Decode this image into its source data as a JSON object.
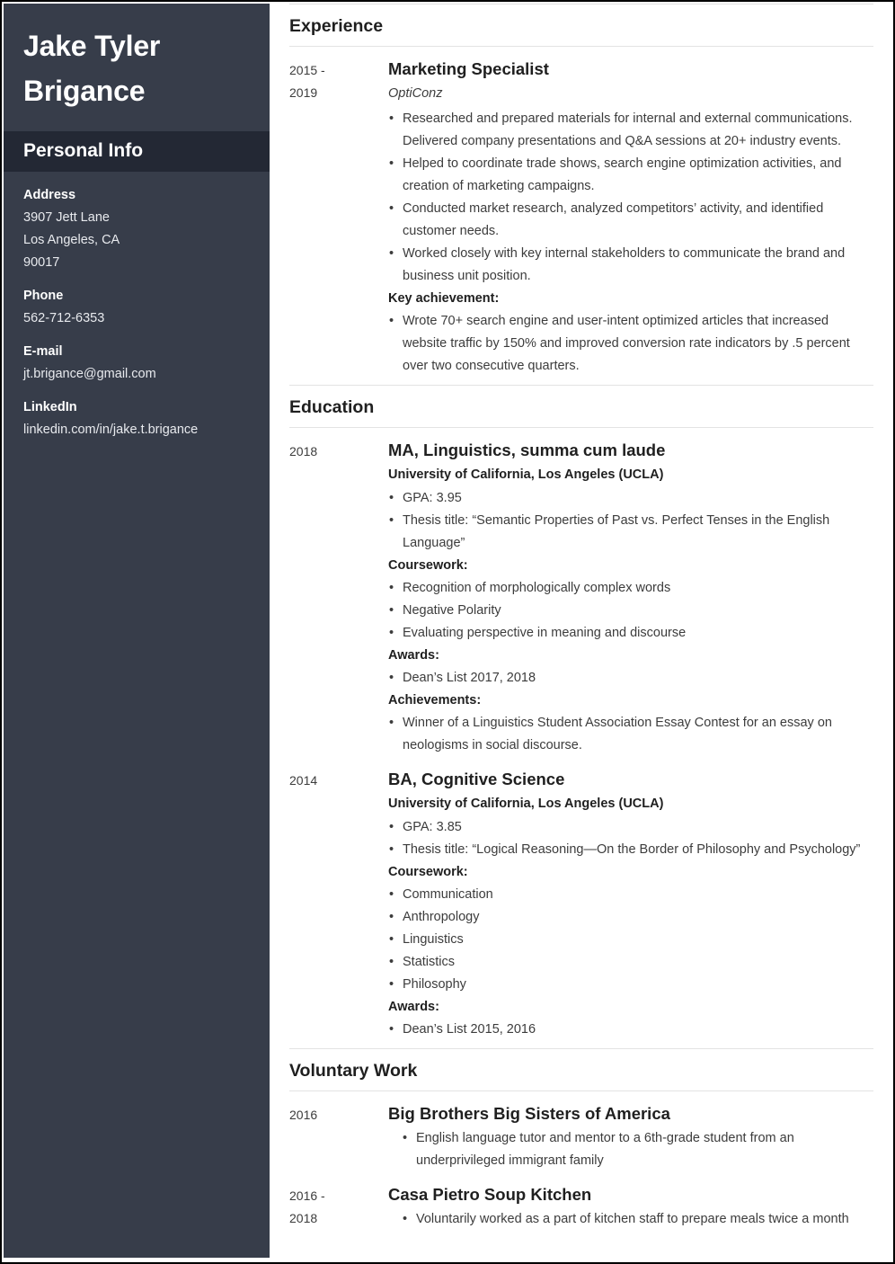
{
  "theme": {
    "sidebar_bg": "#373d4a",
    "sidebar_band_bg": "#232834",
    "sidebar_text": "#ffffff",
    "main_bg": "#ffffff",
    "heading_color": "#1f1f1f",
    "body_color": "#3c3c3c",
    "rule_color": "#e3e3e3",
    "page_border": "#000000"
  },
  "sidebar": {
    "name_line1": "Jake Tyler",
    "name_line2": "Brigance",
    "personal_info_title": "Personal Info",
    "info": [
      {
        "label": "Address",
        "values": [
          "3907 Jett Lane",
          "Los Angeles, CA",
          "90017"
        ]
      },
      {
        "label": "Phone",
        "values": [
          "562-712-6353"
        ]
      },
      {
        "label": "E-mail",
        "values": [
          "jt.brigance@gmail.com"
        ]
      },
      {
        "label": "LinkedIn",
        "values": [
          "linkedin.com/in/jake.t.brigance"
        ]
      }
    ]
  },
  "main": {
    "sections": [
      {
        "heading": "Experience",
        "entries": [
          {
            "dates_line1": "2015 -",
            "dates_line2": "2019",
            "title": "Marketing Specialist",
            "org_italic": "OptiConz",
            "bullets": [
              "Researched and prepared materials for internal and external communications. Delivered company presentations and Q&A sessions at 20+ industry events.",
              "Helped to coordinate trade shows, search engine optimization activities, and creation of marketing campaigns.",
              "Conducted market research, analyzed competitors’ activity, and identified customer needs.",
              "Worked closely with key internal stakeholders to communicate the brand and business unit position."
            ],
            "sub_label": "Key achievement:",
            "sub_bullets": [
              "Wrote 70+ search engine and user-intent optimized articles that increased website traffic by 150% and improved conversion rate indicators by .5 percent over two consecutive quarters."
            ]
          }
        ]
      },
      {
        "heading": "Education",
        "entries": [
          {
            "dates_line1": "2018",
            "dates_line2": "",
            "title": "MA, Linguistics, summa cum laude",
            "org_bold": "University of California, Los Angeles (UCLA)",
            "bullets": [
              "GPA: 3.95",
              "Thesis title: “Semantic Properties of Past vs. Perfect Tenses in the English Language”"
            ],
            "groups": [
              {
                "label": "Coursework:",
                "items": [
                  "Recognition of morphologically complex words",
                  "Negative Polarity",
                  "Evaluating perspective in meaning and discourse"
                ]
              },
              {
                "label": "Awards:",
                "items": [
                  "Dean’s List 2017, 2018"
                ]
              },
              {
                "label": "Achievements:",
                "items": [
                  "Winner of a Linguistics Student Association Essay Contest for an essay on neologisms in social discourse."
                ]
              }
            ]
          },
          {
            "dates_line1": "2014",
            "dates_line2": "",
            "title": "BA, Cognitive Science",
            "org_bold": "University of California, Los Angeles (UCLA)",
            "bullets": [
              "GPA: 3.85",
              "Thesis title: “Logical Reasoning—On the Border of Philosophy and Psychology”"
            ],
            "groups": [
              {
                "label": "Coursework:",
                "items": [
                  "Communication",
                  "Anthropology",
                  "Linguistics",
                  "Statistics",
                  "Philosophy"
                ]
              },
              {
                "label": "Awards:",
                "items": [
                  "Dean’s List 2015, 2016"
                ]
              }
            ]
          }
        ]
      },
      {
        "heading": "Voluntary Work",
        "entries": [
          {
            "dates_line1": "2016",
            "dates_line2": "",
            "title": "Big Brothers Big Sisters of America",
            "indented_bullets": [
              "English language tutor and mentor to a 6th-grade student from an underprivileged immigrant family"
            ]
          },
          {
            "dates_line1": "2016 -",
            "dates_line2": "2018",
            "title": "Casa Pietro Soup Kitchen",
            "indented_bullets": [
              "Voluntarily worked as a part of kitchen staff to prepare meals twice a month"
            ]
          }
        ]
      }
    ]
  }
}
